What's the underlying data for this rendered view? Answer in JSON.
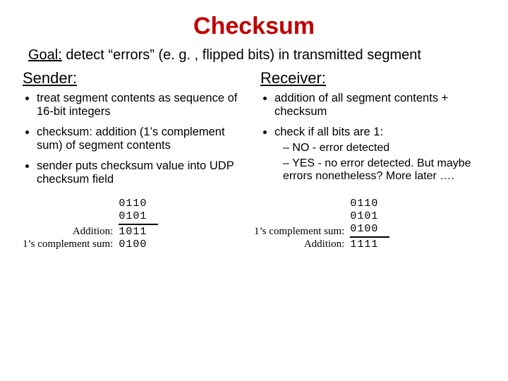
{
  "title": "Checksum",
  "goal_label": "Goal:",
  "goal_text": " detect “errors” (e. g. , flipped bits) in transmitted segment",
  "sender": {
    "heading": "Sender:",
    "bullets": [
      "treat segment contents as sequence of 16-bit integers",
      "checksum: addition (1’s complement sum) of segment contents",
      "sender puts checksum value into UDP checksum field"
    ]
  },
  "receiver": {
    "heading": "Receiver:",
    "bullet1": "addition of all segment contents + checksum",
    "bullet2_lead": "check if all bits are 1:",
    "sub": [
      "NO - error detected",
      "YES - no error detected. But maybe errors nonetheless? More later …."
    ]
  },
  "calc_left": {
    "label_add": "Addition:",
    "label_comp": "1’s complement sum:",
    "n1": "0110",
    "n2": "0101",
    "sum": "1011",
    "comp": "0100"
  },
  "calc_right": {
    "label_comp": "1’s complement sum:",
    "label_add": "Addition:",
    "n1": "0110",
    "n2": "0101",
    "n3": "0100",
    "sum": "1111"
  }
}
